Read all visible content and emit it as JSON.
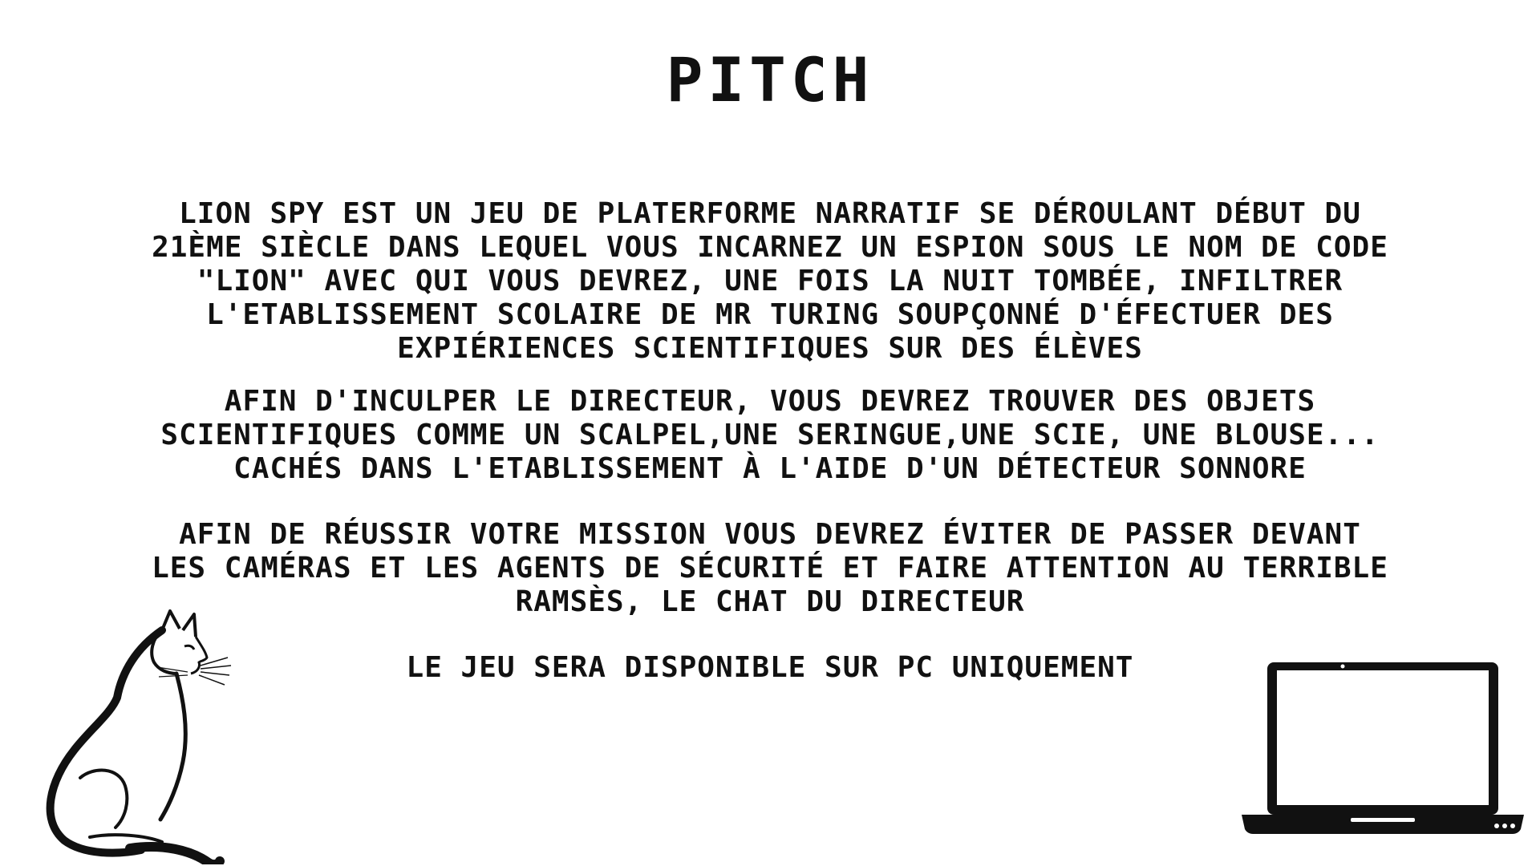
{
  "slide": {
    "title": "PITCH",
    "paragraphs": [
      {
        "lines": [
          "LION SPY  EST UN  JEU DE PLATERFORME NARRATIF SE DÉROULANT DÉBUT DU",
          "21ÈME SIÈCLE DANS LEQUEL VOUS INCARNEZ UN ESPION SOUS LE NOM DE CODE",
          "\"LION\" AVEC QUI VOUS DEVREZ, UNE FOIS LA NUIT TOMBÉE, INFILTRER",
          "L'ETABLISSEMENT SCOLAIRE DE MR TURING SOUPÇONNÉ D'ÉFECTUER DES",
          "EXPIÉRIENCES SCIENTIFIQUES SUR DES ÉLÈVES"
        ]
      },
      {
        "lines": [
          "AFIN D'INCULPER LE DIRECTEUR, VOUS DEVREZ TROUVER DES OBJETS",
          "SCIENTIFIQUES COMME UN SCALPEL,UNE SERINGUE,UNE SCIE, UNE BLOUSE...",
          "CACHÉS DANS L'ETABLISSEMENT À L'AIDE D'UN DÉTECTEUR SONNORE"
        ]
      },
      {
        "lines": [
          "AFIN DE RÉUSSIR VOTRE MISSION VOUS DEVREZ ÉVITER DE PASSER DEVANT",
          "LES CAMÉRAS ET LES AGENTS DE SÉCURITÉ ET FAIRE ATTENTION AU TERRIBLE",
          "RAMSÈS, LE CHAT DU DIRECTEUR"
        ]
      },
      {
        "lines": [
          "LE JEU SERA DISPONIBLE SUR PC UNIQUEMENT"
        ]
      }
    ]
  },
  "icons": {
    "cat": "cat-illustration",
    "laptop": "laptop-icon"
  },
  "colors": {
    "text": "#111111",
    "background": "#ffffff"
  }
}
